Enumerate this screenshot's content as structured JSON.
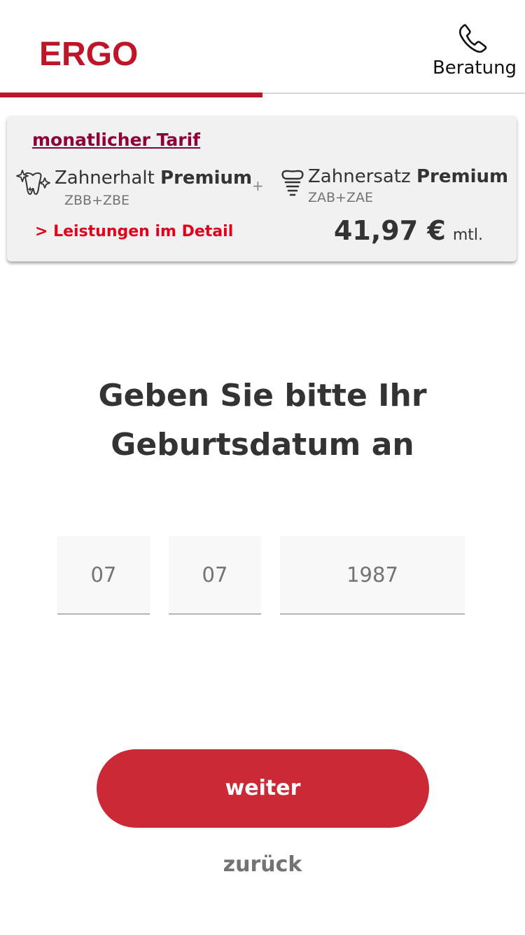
{
  "header": {
    "logo": "ERGO",
    "beratung_label": "Beratung",
    "progress_fraction": 0.5
  },
  "tarif": {
    "link_label": "monatlicher Tarif",
    "product1": {
      "name": "Zahnerhalt",
      "tier": "Premium",
      "code": "ZBB+ZBE"
    },
    "plus": "+",
    "product2": {
      "name": "Zahnersatz",
      "tier": "Premium",
      "code": "ZAB+ZAE"
    },
    "detail_link": "> Leistungen im Detail",
    "price": "41,97 €",
    "price_unit": "mtl."
  },
  "question": {
    "line1": "Geben Sie bitte Ihr",
    "line2": "Geburtsdatum an"
  },
  "birthdate": {
    "day": "07",
    "month": "07",
    "year": "1987"
  },
  "buttons": {
    "next": "weiter",
    "back": "zurück"
  },
  "colors": {
    "brand": "#bf1528",
    "button": "#cc2936",
    "link": "#8e0038",
    "detail_link": "#e3001b"
  },
  "icons": {
    "beratung": "phone-icon",
    "product1": "sparkling-tooth-icon",
    "product2": "dental-implant-icon"
  }
}
